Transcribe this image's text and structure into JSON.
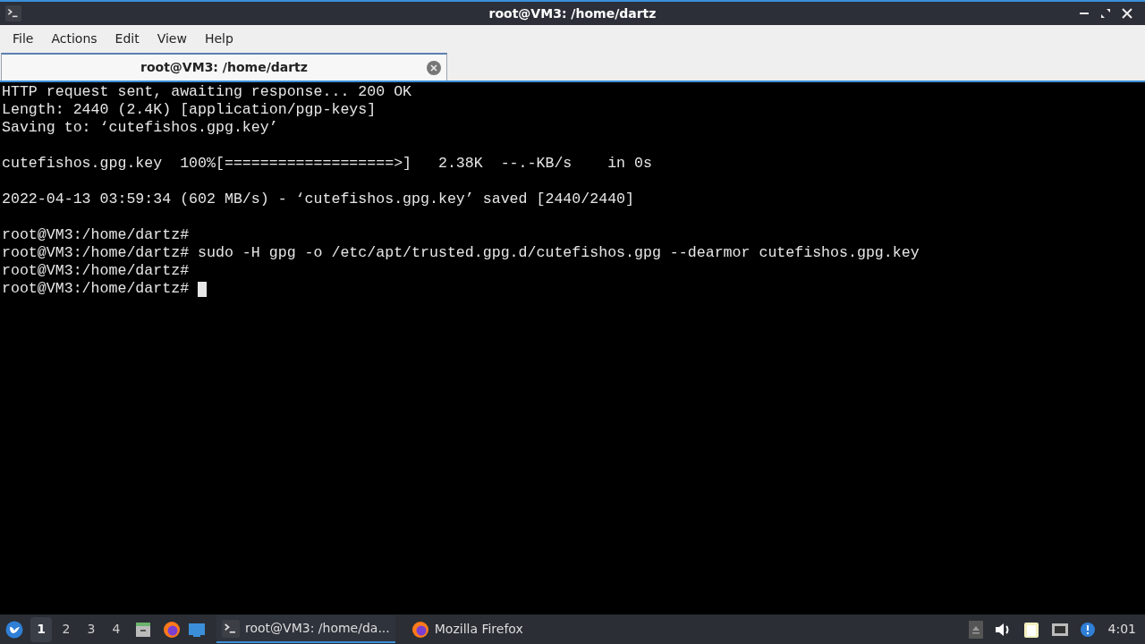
{
  "window": {
    "title": "root@VM3: /home/dartz"
  },
  "menu": [
    "File",
    "Actions",
    "Edit",
    "View",
    "Help"
  ],
  "tabs": [
    {
      "label": "root@VM3: /home/dartz",
      "selected": true
    }
  ],
  "terminal": {
    "blocks": [
      [
        "HTTP request sent, awaiting response... 200 OK",
        "Length: 2440 (2.4K) [application/pgp-keys]",
        "Saving to: ‘cutefishos.gpg.key’"
      ],
      [
        "cutefishos.gpg.key  100%[===================>]   2.38K  --.-KB/s    in 0s"
      ],
      [
        "2022-04-13 03:59:34 (602 MB/s) - ‘cutefishos.gpg.key’ saved [2440/2440]"
      ],
      [
        "root@VM3:/home/dartz#",
        "root@VM3:/home/dartz# sudo -H gpg -o /etc/apt/trusted.gpg.d/cutefishos.gpg --dearmor cutefishos.gpg.key",
        "root@VM3:/home/dartz#",
        "root@VM3:/home/dartz# "
      ]
    ]
  },
  "taskbar": {
    "workspaces": [
      {
        "label": "1",
        "selected": true
      },
      {
        "label": "2",
        "selected": false
      },
      {
        "label": "3",
        "selected": false
      },
      {
        "label": "4",
        "selected": false
      }
    ],
    "tasks": [
      {
        "kind": "terminal",
        "label": "root@VM3: /home/da...",
        "selected": true
      },
      {
        "kind": "browser",
        "label": "Mozilla Firefox",
        "selected": false
      }
    ],
    "clock": "4:01"
  }
}
